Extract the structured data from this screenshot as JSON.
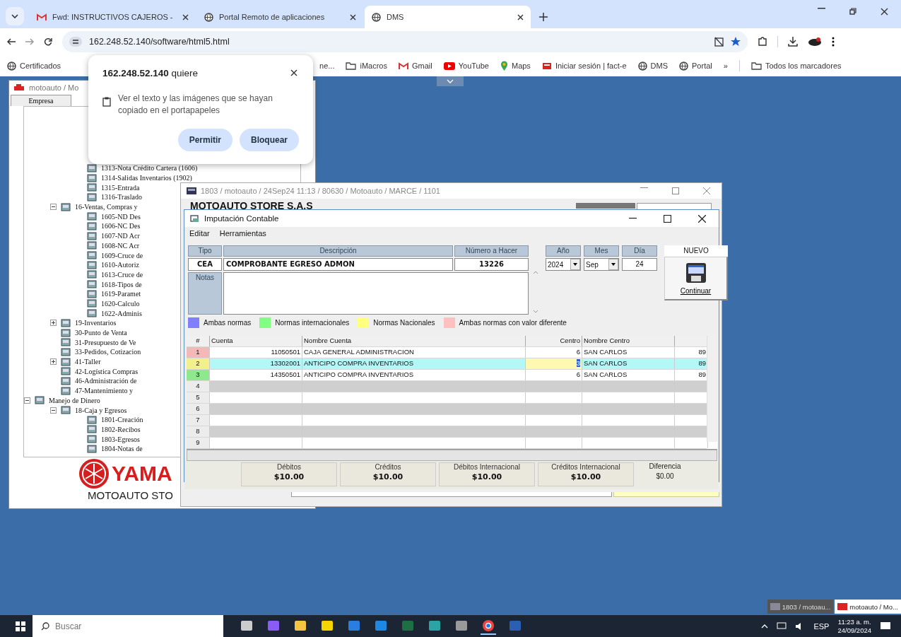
{
  "browser": {
    "tabs": [
      {
        "title": "Fwd: INSTRUCTIVOS CAJEROS -",
        "kind": "gmail",
        "selected": false
      },
      {
        "title": "Portal Remoto de aplicaciones",
        "kind": "globe",
        "selected": false
      },
      {
        "title": "DMS",
        "kind": "globe",
        "selected": true
      }
    ],
    "address": "162.248.52.140/software/html5.html",
    "bookmarks": [
      {
        "label": "Certificados",
        "kind": "globe"
      },
      {
        "label": "ne..."
      },
      {
        "label": "iMacros",
        "kind": "folder"
      },
      {
        "label": "Gmail",
        "kind": "gmail"
      },
      {
        "label": "YouTube",
        "kind": "youtube"
      },
      {
        "label": "Maps",
        "kind": "maps"
      },
      {
        "label": "Iniciar sesión | fact-e",
        "kind": "fact"
      },
      {
        "label": "DMS",
        "kind": "globe"
      },
      {
        "label": "Portal",
        "kind": "globe"
      }
    ],
    "more": "»",
    "all_bookmarks": "Todos los marcadores"
  },
  "permission_popup": {
    "title": "**162.248.52.140** quiere",
    "text": "Ver el texto y las imágenes que se hayan copiado en el portapapeles",
    "buttons": [
      "Permitir",
      "Bloquear"
    ]
  },
  "tree_window": {
    "title": "motoauto / Mo",
    "tabs": [
      "Empresa"
    ],
    "tree": [
      {
        "children": [
          {
            "children": [
              {
                "label": "1313-Nota Crédito Cartera (1606)"
              },
              {
                "label": "1314-Salidas Inventarios (1902)"
              },
              {
                "label": "1315-Entrada"
              },
              {
                "label": "1316-Traslado"
              }
            ]
          },
          {
            "label": "16-Ventas, Compras y",
            "expanded": true,
            "children": [
              {
                "label": "1605-ND Des"
              },
              {
                "label": "1606-NC Des"
              },
              {
                "label": "1607-ND Acr"
              },
              {
                "label": "1608-NC Acr"
              },
              {
                "label": "1609-Cruce de"
              },
              {
                "label": "1610-Autoriz"
              },
              {
                "label": "1613-Cruce de"
              },
              {
                "label": "1618-Tipos de"
              },
              {
                "label": "1619-Paramet"
              },
              {
                "label": "1620-Calculo"
              },
              {
                "label": "1622-Adminis"
              }
            ]
          },
          {
            "label": "19-Inventarios",
            "expanded": false
          },
          {
            "label": "30-Punto de Venta"
          },
          {
            "label": "31-Presupuesto de Ve"
          },
          {
            "label": "33-Pedidos, Cotizacion"
          },
          {
            "label": "41-Taller",
            "expanded": false
          },
          {
            "label": "42-Logística Compras"
          },
          {
            "label": "46-Administración de"
          },
          {
            "label": "47-Mantenimiento y"
          }
        ]
      },
      {
        "label": "Manejo de Dinero",
        "expanded": true,
        "children": [
          {
            "label": "18-Caja y Egresos",
            "expanded": true,
            "children": [
              {
                "label": "1801-Creación"
              },
              {
                "label": "1802-Recibos"
              },
              {
                "label": "1803-Egresos"
              },
              {
                "label": "1804-Notas de"
              }
            ]
          }
        ]
      }
    ],
    "logo_text": "YAMA",
    "company": "MOTOAUTO STO"
  },
  "form_window": {
    "title": "1803 / motoauto / 24Sep24 11:13 / 80630 / Motoauto / MARCE / 1101",
    "company": "MOTOAUTO STORE S.A.S"
  },
  "dialog": {
    "title": "Imputación Contable",
    "menu": [
      "Editar",
      "Herramientas"
    ],
    "fields": {
      "tipo": {
        "label": "Tipo",
        "value": "CEA"
      },
      "descripcion": {
        "label": "Descripción",
        "value": "COMPROBANTE EGRESO ADMON"
      },
      "numero": {
        "label": "Número a Hacer",
        "value": "13226"
      },
      "notas": {
        "label": "Notas"
      },
      "anio": {
        "label": "Año",
        "value": "2024"
      },
      "mes": {
        "label": "Mes",
        "value": "Sep"
      },
      "dia": {
        "label": "Día",
        "value": "24"
      }
    },
    "nuevo": "NUEVO",
    "continue_button": "Continuar",
    "legend": [
      {
        "label": "Ambas normas",
        "color": "#8080ff"
      },
      {
        "label": "Normas internacionales",
        "color": "#80ff80"
      },
      {
        "label": "Normas Nacionales",
        "color": "#ffff80"
      },
      {
        "label": "Ambas normas con valor diferente",
        "color": "#ffc0c0"
      }
    ],
    "grid": {
      "columns": [
        "#",
        "Cuenta",
        "Nombre Cuenta",
        "Centro",
        "Nombre Centro"
      ],
      "rows": [
        {
          "number": "1",
          "color": "#f4b8b8",
          "cuenta": "11050501",
          "nombre_cuenta": "CAJA GENERAL ADMINISTRACION",
          "centro": "6",
          "nombre_centro": "SAN CARLOS",
          "column_6": "89",
          "selected": false,
          "editing": false
        },
        {
          "number": "2",
          "color": "#f2f08a",
          "cuenta": "13302001",
          "nombre_cuenta": "ANTICIPO COMPRA INVENTARIOS",
          "centro": "3",
          "nombre_centro": "SAN CARLOS",
          "column_6": "89",
          "selected": true,
          "editing": true
        },
        {
          "number": "3",
          "color": "#8ee88e",
          "cuenta": "14350501",
          "nombre_cuenta": "ANTICIPO COMPRA INVENTARIOS",
          "centro": "6",
          "nombre_centro": "SAN CARLOS",
          "column_6": "89",
          "selected": false,
          "editing": false
        },
        {
          "number": "4"
        },
        {
          "number": "5"
        },
        {
          "number": "6"
        },
        {
          "number": "7"
        },
        {
          "number": "8"
        },
        {
          "number": "9"
        }
      ]
    },
    "totals": [
      {
        "label": "Débitos",
        "value": "$10.00"
      },
      {
        "label": "Créditos",
        "value": "$10.00"
      },
      {
        "label": "Débitos Internacional",
        "value": "$10.00"
      },
      {
        "label": "Créditos Internacional",
        "value": "$10.00"
      }
    ],
    "difference": {
      "label": "Diferencia",
      "value": "$0.00"
    }
  },
  "taskbar_windows": [
    {
      "title": "1803 / motoau...",
      "selected": false
    },
    {
      "title": "motoauto / Mo...",
      "selected": true
    }
  ],
  "taskbar": {
    "search_placeholder": "Buscar",
    "apps": [
      {
        "kind": "taskview",
        "selected": false
      },
      {
        "kind": "copilot",
        "selected": false
      },
      {
        "kind": "explorer",
        "selected": false
      },
      {
        "kind": "notes",
        "selected": false
      },
      {
        "kind": "store",
        "selected": false
      },
      {
        "kind": "mail",
        "selected": false
      },
      {
        "kind": "excel",
        "selected": false
      },
      {
        "kind": "edge",
        "selected": false
      },
      {
        "kind": "app",
        "selected": false
      },
      {
        "kind": "chrome",
        "selected": true
      },
      {
        "kind": "word",
        "selected": false
      }
    ],
    "language": "ESP",
    "time": "11:23 a. m.",
    "date": "24/09/2024"
  }
}
